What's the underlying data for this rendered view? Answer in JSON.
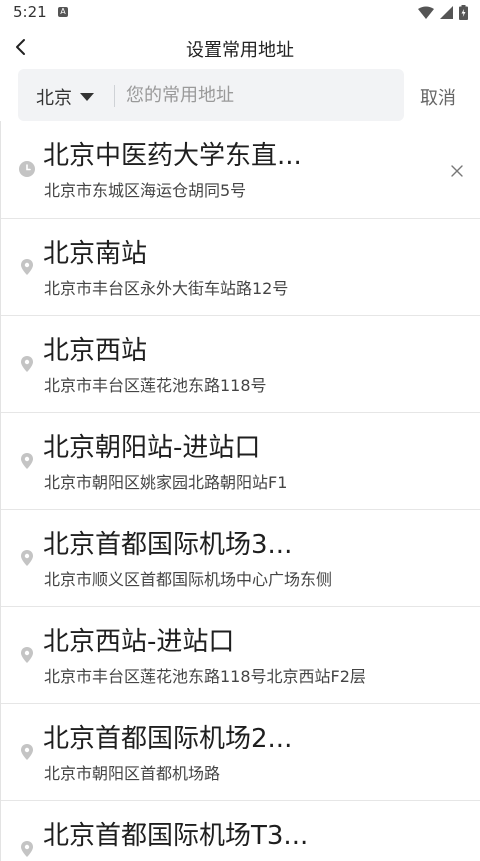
{
  "status_bar": {
    "time": "5:21",
    "notification_letter": "A"
  },
  "header": {
    "title": "设置常用地址"
  },
  "search": {
    "city": "北京",
    "placeholder": "您的常用地址",
    "value": "",
    "cancel_label": "取消"
  },
  "list": {
    "items": [
      {
        "name": "北京中医药大学东直...",
        "address": "北京市东城区海运仓胡同5号",
        "icon": "clock-icon",
        "deletable": true
      },
      {
        "name": "北京南站",
        "address": "北京市丰台区永外大街车站路12号",
        "icon": "location-pin-icon"
      },
      {
        "name": "北京西站",
        "address": "北京市丰台区莲花池东路118号",
        "icon": "location-pin-icon"
      },
      {
        "name": "北京朝阳站-进站口",
        "address": "北京市朝阳区姚家园北路朝阳站F1",
        "icon": "location-pin-icon"
      },
      {
        "name": "北京首都国际机场3...",
        "address": "北京市顺义区首都国际机场中心广场东侧",
        "icon": "location-pin-icon"
      },
      {
        "name": "北京西站-进站口",
        "address": "北京市丰台区莲花池东路118号北京西站F2层",
        "icon": "location-pin-icon"
      },
      {
        "name": "北京首都国际机场2...",
        "address": "北京市朝阳区首都机场路",
        "icon": "location-pin-icon"
      },
      {
        "name": "北京首都国际机场T3...",
        "address": "",
        "icon": "location-pin-icon"
      }
    ]
  },
  "colors": {
    "icon_gray": "#c4c4c4",
    "search_bg": "#f2f3f5",
    "divider": "#e6e6e6"
  }
}
